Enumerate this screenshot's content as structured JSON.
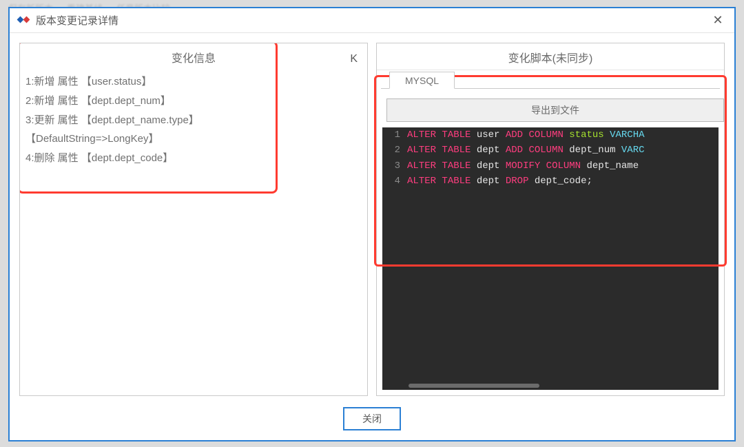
{
  "bg": {
    "tabs": [
      "保存新版本",
      "重建基线",
      "任意版本比较"
    ]
  },
  "dialog": {
    "title": "版本变更记录详情",
    "close_btn": "关闭"
  },
  "left_panel": {
    "title": "变化信息",
    "k_marker": "K",
    "items": [
      "1:新增 属性 【user.status】",
      "2:新增 属性 【dept.dept_num】",
      "3:更新 属性 【dept.dept_name.type】",
      "  【DefaultString=>LongKey】",
      "4:删除 属性 【dept.dept_code】"
    ]
  },
  "right_panel": {
    "title": "变化脚本(未同步)",
    "tab": "MYSQL",
    "export_btn": "导出到文件",
    "code_lines": [
      {
        "n": "1",
        "tokens": [
          {
            "t": "ALTER ",
            "c": "tk-kw"
          },
          {
            "t": "TABLE ",
            "c": "tk-kw"
          },
          {
            "t": "user ",
            "c": "tk-id"
          },
          {
            "t": "ADD ",
            "c": "tk-kw"
          },
          {
            "t": "COLUMN ",
            "c": "tk-kw"
          },
          {
            "t": "status ",
            "c": "tk-green"
          },
          {
            "t": "VARCHA",
            "c": "tk-cyan"
          }
        ]
      },
      {
        "n": "2",
        "tokens": [
          {
            "t": "ALTER ",
            "c": "tk-kw"
          },
          {
            "t": "TABLE ",
            "c": "tk-kw"
          },
          {
            "t": "dept ",
            "c": "tk-id"
          },
          {
            "t": "ADD ",
            "c": "tk-kw"
          },
          {
            "t": "COLUMN ",
            "c": "tk-kw"
          },
          {
            "t": "dept_num ",
            "c": "tk-id"
          },
          {
            "t": "VARC",
            "c": "tk-cyan"
          }
        ]
      },
      {
        "n": "3",
        "tokens": [
          {
            "t": "ALTER ",
            "c": "tk-kw"
          },
          {
            "t": "TABLE ",
            "c": "tk-kw"
          },
          {
            "t": "dept ",
            "c": "tk-id"
          },
          {
            "t": "MODIFY ",
            "c": "tk-kw"
          },
          {
            "t": "COLUMN ",
            "c": "tk-kw"
          },
          {
            "t": "dept_name ",
            "c": "tk-id"
          }
        ]
      },
      {
        "n": "4",
        "tokens": [
          {
            "t": "ALTER ",
            "c": "tk-kw"
          },
          {
            "t": "TABLE ",
            "c": "tk-kw"
          },
          {
            "t": "dept ",
            "c": "tk-id"
          },
          {
            "t": "DROP ",
            "c": "tk-kw"
          },
          {
            "t": "dept_code;",
            "c": "tk-id"
          }
        ]
      }
    ]
  }
}
